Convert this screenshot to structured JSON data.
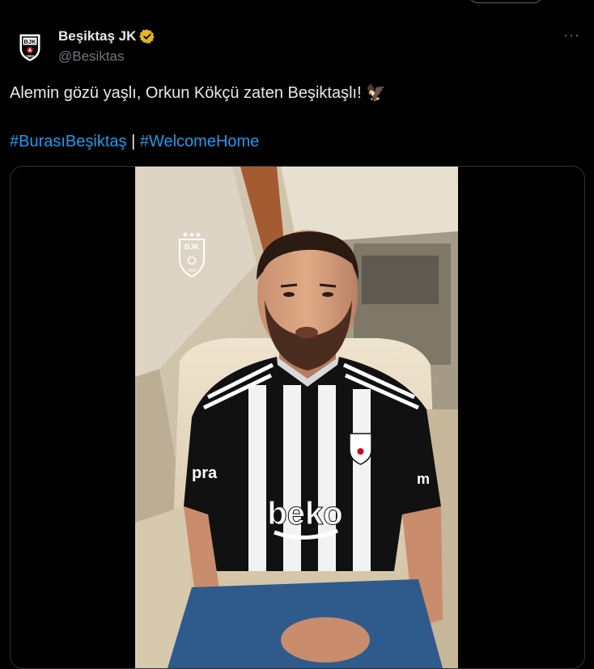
{
  "tweet": {
    "author": {
      "display_name": "Beşiktaş JK",
      "handle": "@Besiktas",
      "verified": true,
      "verified_color": "#e2b719",
      "avatar_icon": "besiktas-crest-icon"
    },
    "more_icon": "more-dots-icon",
    "more_label": "···",
    "text": "Alemin gözü yaşlı, Orkun Kökçü zaten Beşiktaşlı! 🦅",
    "hashtags": [
      "#BurasıBeşiktaş",
      "#WelcomeHome"
    ],
    "hashtag_separator": "|",
    "link_color": "#1d9bf0",
    "media": {
      "type": "video",
      "overlay_icon": "besiktas-crest-icon",
      "jersey_sponsor": "beko",
      "jersey_sleeve_text": "pra",
      "jersey_sleeve_text_right": "m"
    }
  }
}
